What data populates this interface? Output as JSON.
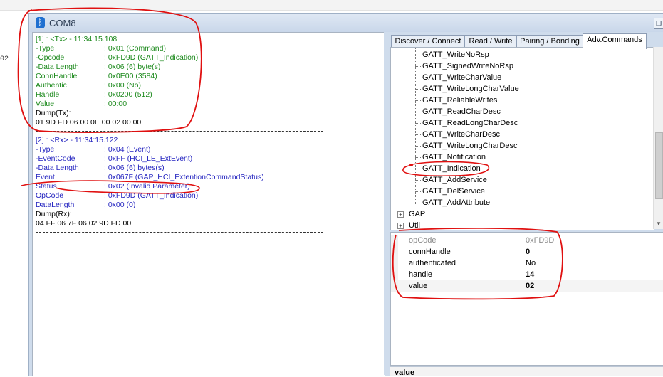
{
  "left_fragment": "02",
  "window": {
    "title": "COM8",
    "restore_glyph": "❐"
  },
  "log": {
    "tx": {
      "header": "[1] : <Tx> - 11:34:15.108",
      "fields": [
        {
          "name": "-Type",
          "value": ": 0x01 (Command)"
        },
        {
          "name": "-Opcode",
          "value": ": 0xFD9D (GATT_Indication)"
        },
        {
          "name": "-Data Length",
          "value": ": 0x06 (6) byte(s)"
        },
        {
          "name": " ConnHandle",
          "value": ": 0x0E00 (3584)"
        },
        {
          "name": " Authentic",
          "value": ": 0x00 (No)"
        },
        {
          "name": " Handle",
          "value": ": 0x0200 (512)"
        },
        {
          "name": " Value",
          "value": ": 00:00"
        }
      ],
      "dump_label": "Dump(Tx):",
      "dump": "01 9D FD 06 00 0E 00 02 00 00"
    },
    "rx": {
      "header": "[2] : <Rx> - 11:34:15.122",
      "fields": [
        {
          "name": "-Type",
          "value": ": 0x04 (Event)"
        },
        {
          "name": "-EventCode",
          "value": ": 0xFF (HCI_LE_ExtEvent)"
        },
        {
          "name": "-Data Length",
          "value": ": 0x06 (6) bytes(s)"
        },
        {
          "name": " Event",
          "value": ": 0x067F (GAP_HCI_ExtentionCommandStatus)"
        },
        {
          "name": " Status",
          "value": ": 0x02 (Invalid Parameter)"
        },
        {
          "name": " OpCode",
          "value": ": 0xFD9D (GATT_Indication)"
        },
        {
          "name": " DataLength",
          "value": ": 0x00 (0)"
        }
      ],
      "dump_label": "Dump(Rx):",
      "dump": "04 FF 06 7F 06 02 9D FD 00"
    }
  },
  "tabs": [
    {
      "label": "Discover / Connect"
    },
    {
      "label": "Read / Write"
    },
    {
      "label": "Pairing / Bonding"
    },
    {
      "label": "Adv.Commands",
      "active": true
    }
  ],
  "tree": {
    "items": [
      "GATT_WriteNoRsp",
      "GATT_SignedWriteNoRsp",
      "GATT_WriteCharValue",
      "GATT_WriteLongCharValue",
      "GATT_ReliableWrites",
      "GATT_ReadCharDesc",
      "GATT_ReadLongCharDesc",
      "GATT_WriteCharDesc",
      "GATT_WriteLongCharDesc",
      "GATT_Notification",
      "GATT_Indication",
      "GATT_AddService",
      "GATT_DelService",
      "GATT_AddAttribute"
    ],
    "nodes": [
      "GAP",
      "Util"
    ],
    "expander_glyph": "+"
  },
  "properties": [
    {
      "name": "opCode",
      "value": "0xFD9D",
      "readonly": true
    },
    {
      "name": "connHandle",
      "value": "0",
      "bold": true
    },
    {
      "name": "authenticated",
      "value": "No"
    },
    {
      "name": "handle",
      "value": "14",
      "bold": true
    },
    {
      "name": "value",
      "value": "02",
      "bold": true,
      "selected": true
    }
  ],
  "description_title": "value",
  "colors": {
    "tx_text": "#1d8a1d",
    "rx_text": "#2525c0",
    "annotation": "#e01010",
    "window_chrome": "#cfdcec"
  },
  "icons": {
    "bluetooth": "ᛒ",
    "scroll_down": "▼"
  }
}
